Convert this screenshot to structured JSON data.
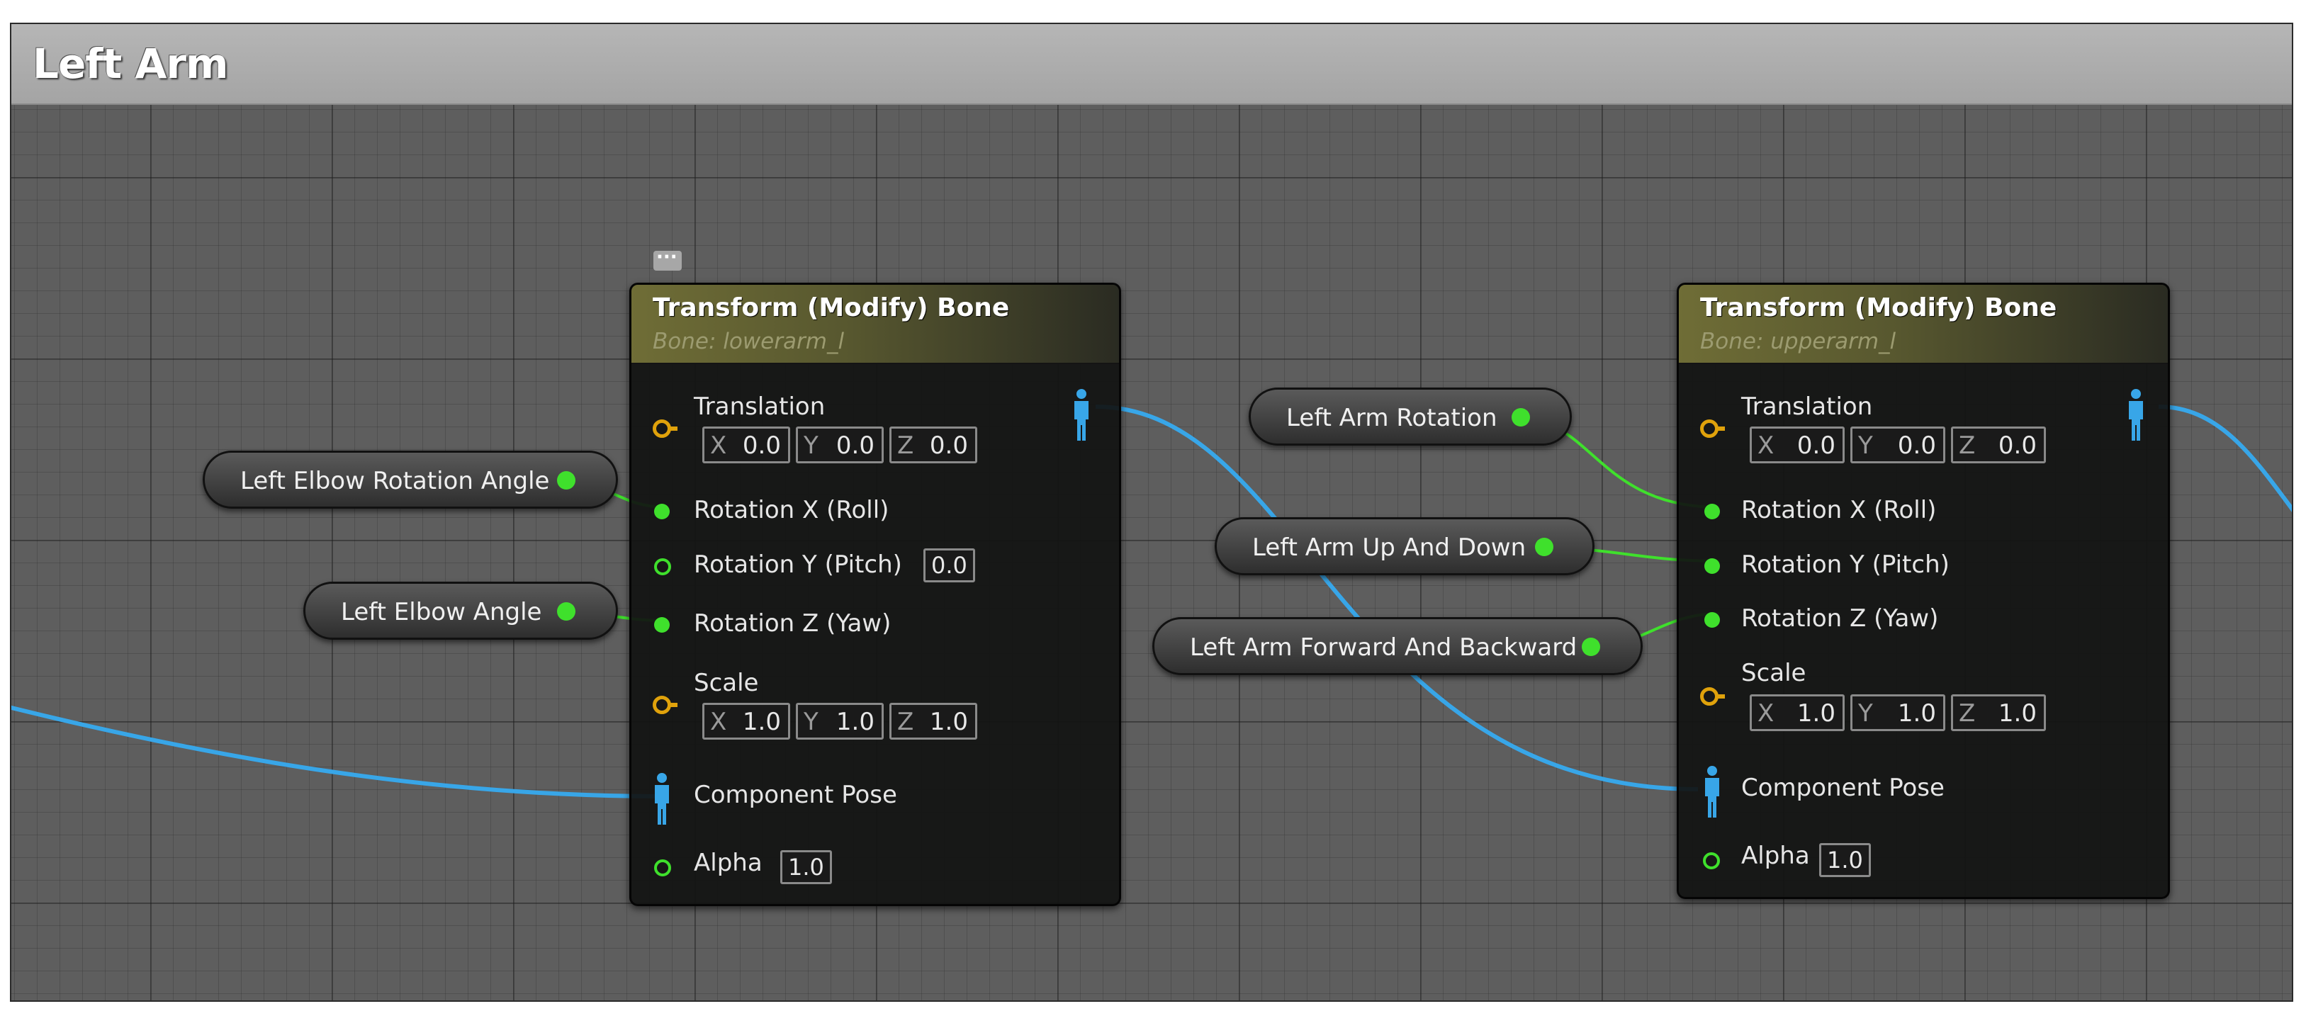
{
  "graph": {
    "title": "Left Arm"
  },
  "colors": {
    "exec_green": "#3fe02c",
    "pose_blue": "#38a6e8",
    "vector_gold": "#e0a20b",
    "node_header": "#6f6d36"
  },
  "nodes": [
    {
      "title": "Transform (Modify) Bone",
      "subtitle": "Bone: lowerarm_l",
      "translation_label": "Translation",
      "translation": {
        "x": "0.0",
        "y": "0.0",
        "z": "0.0"
      },
      "rot_x_label": "Rotation X (Roll)",
      "rot_y_label": "Rotation Y (Pitch)",
      "rot_y_value": "0.0",
      "rot_z_label": "Rotation Z (Yaw)",
      "scale_label": "Scale",
      "scale": {
        "x": "1.0",
        "y": "1.0",
        "z": "1.0"
      },
      "pose_label": "Component Pose",
      "alpha_label": "Alpha",
      "alpha_value": "1.0"
    },
    {
      "title": "Transform (Modify) Bone",
      "subtitle": "Bone: upperarm_l",
      "translation_label": "Translation",
      "translation": {
        "x": "0.0",
        "y": "0.0",
        "z": "0.0"
      },
      "rot_x_label": "Rotation X (Roll)",
      "rot_y_label": "Rotation Y (Pitch)",
      "rot_z_label": "Rotation Z (Yaw)",
      "scale_label": "Scale",
      "scale": {
        "x": "1.0",
        "y": "1.0",
        "z": "1.0"
      },
      "pose_label": "Component Pose",
      "alpha_label": "Alpha",
      "alpha_value": "1.0"
    }
  ],
  "variables": [
    {
      "label": "Left Elbow Rotation Angle"
    },
    {
      "label": "Left Elbow Angle"
    },
    {
      "label": "Left Arm Rotation"
    },
    {
      "label": "Left Arm Up And Down"
    },
    {
      "label": "Left Arm Forward And Backward"
    }
  ],
  "axis_labels": {
    "x": "X",
    "y": "Y",
    "z": "Z"
  }
}
